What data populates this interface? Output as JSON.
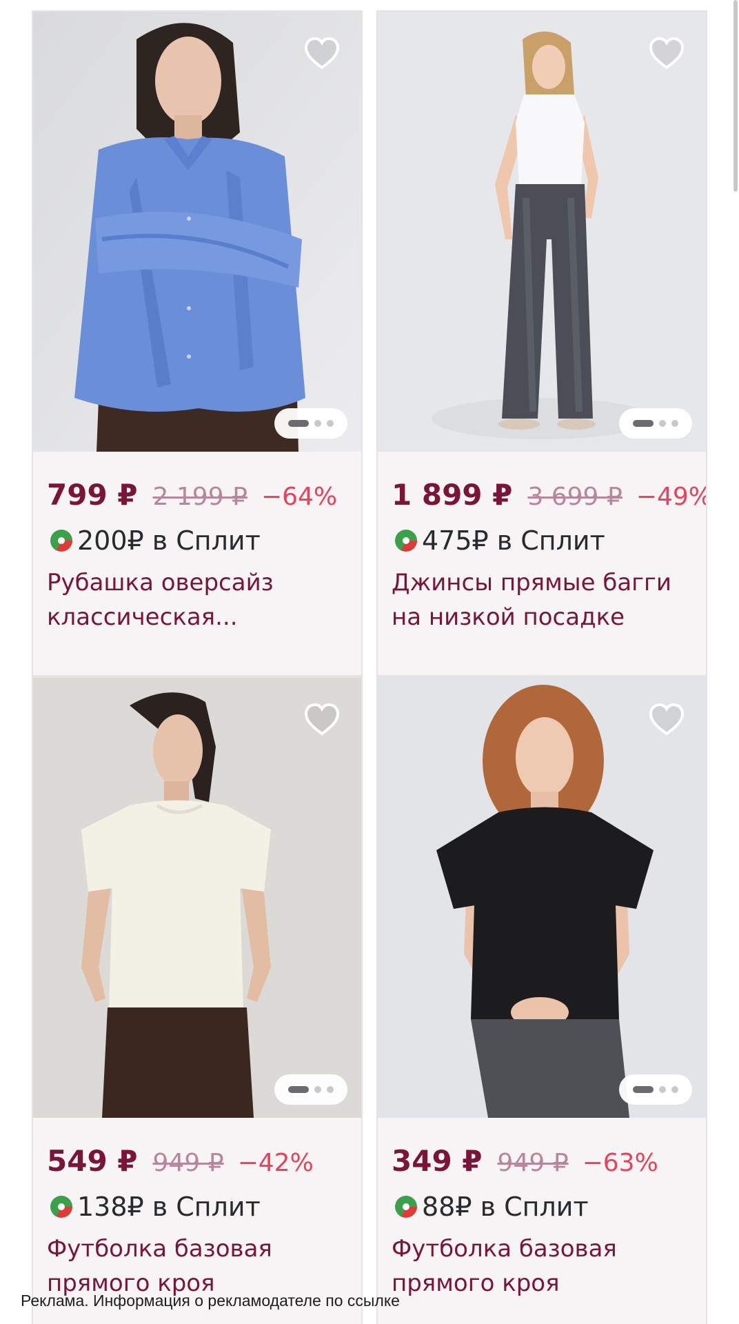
{
  "products": [
    {
      "price": "799 ₽",
      "old_price": "2 199 ₽",
      "discount": "−64%",
      "split_amount": "200₽ в Сплит",
      "title": "Рубашка оверсайз классическая...",
      "favorite_icon": "heart-outline-icon",
      "photo_slides": 3,
      "active_slide": 1
    },
    {
      "price": "1 899 ₽",
      "old_price": "3 699 ₽",
      "discount": "−49%",
      "split_amount": "475₽ в Сплит",
      "title": "Джинсы прямые багги на низкой посадке",
      "favorite_icon": "heart-outline-icon",
      "photo_slides": 3,
      "active_slide": 1
    },
    {
      "price": "549 ₽",
      "old_price": "949 ₽",
      "discount": "−42%",
      "split_amount": "138₽ в Сплит",
      "title": "Футболка базовая прямого кроя",
      "favorite_icon": "heart-outline-icon",
      "photo_slides": 3,
      "active_slide": 1
    },
    {
      "price": "349 ₽",
      "old_price": "949 ₽",
      "discount": "−63%",
      "split_amount": "88₽ в Сплит",
      "title": "Футболка базовая прямого кроя",
      "favorite_icon": "heart-outline-icon",
      "photo_slides": 3,
      "active_slide": 1
    }
  ],
  "ad_disclaimer": "Реклама. Информация о рекламодателе по ссылке",
  "colors": {
    "price": "#7a1438",
    "discount": "#e8415a",
    "old_price": "#b8869a",
    "card_bg": "#f6f4f5",
    "split_green": "#3aa04a",
    "split_red": "#e03a3a"
  }
}
